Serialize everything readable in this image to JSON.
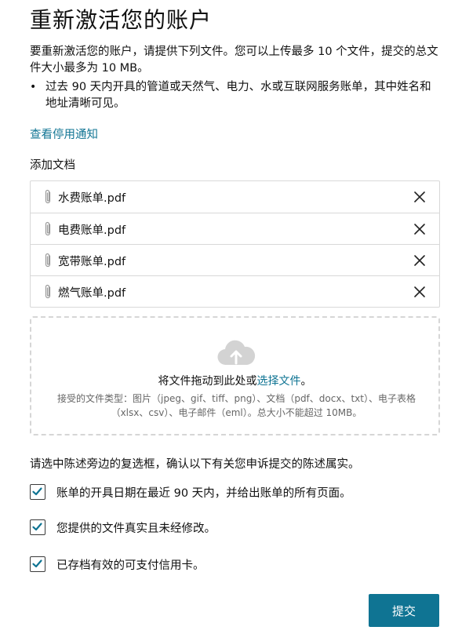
{
  "page": {
    "title": "重新激活您的账户",
    "intro": "要重新激活您的账户，请提供下列文件。您可以上传最多 10 个文件，提交的总文件大小最多为 10 MB。",
    "bullet": "过去 90 天内开具的管道或天然气、电力、水或互联网服务账单，其中姓名和地址清晰可见。",
    "notice_link": "查看停用通知",
    "add_documents_label": "添加文档"
  },
  "files": [
    {
      "name": "水费账单.pdf"
    },
    {
      "name": "电费账单.pdf"
    },
    {
      "name": "宽带账单.pdf"
    },
    {
      "name": "燃气账单.pdf"
    }
  ],
  "dropzone": {
    "main_prefix": "将文件拖动到此处或",
    "choose_link": "选择文件",
    "main_suffix": "。",
    "hint": "接受的文件类型：图片（jpeg、gif、tiff、png）、文档（pdf、docx、txt）、电子表格（xlsx、csv）、电子邮件（eml）。总大小不能超过 10MB。"
  },
  "confirm": {
    "instruction": "请选中陈述旁边的复选框，确认以下有关您申诉提交的陈述属实。",
    "items": [
      {
        "label": "账单的开具日期在最近 90 天内，并给出账单的所有页面。",
        "checked": true
      },
      {
        "label": "您提供的文件真实且未经修改。",
        "checked": true
      },
      {
        "label": "已存档有效的可支付信用卡。",
        "checked": true
      }
    ]
  },
  "submit_label": "提交",
  "colors": {
    "accent": "#0f7493",
    "border": "#d8d8d8",
    "text": "#111111"
  },
  "icons": {
    "file": "paperclip-icon",
    "remove": "close-icon",
    "upload": "cloud-upload-icon",
    "check": "checkmark-icon"
  }
}
